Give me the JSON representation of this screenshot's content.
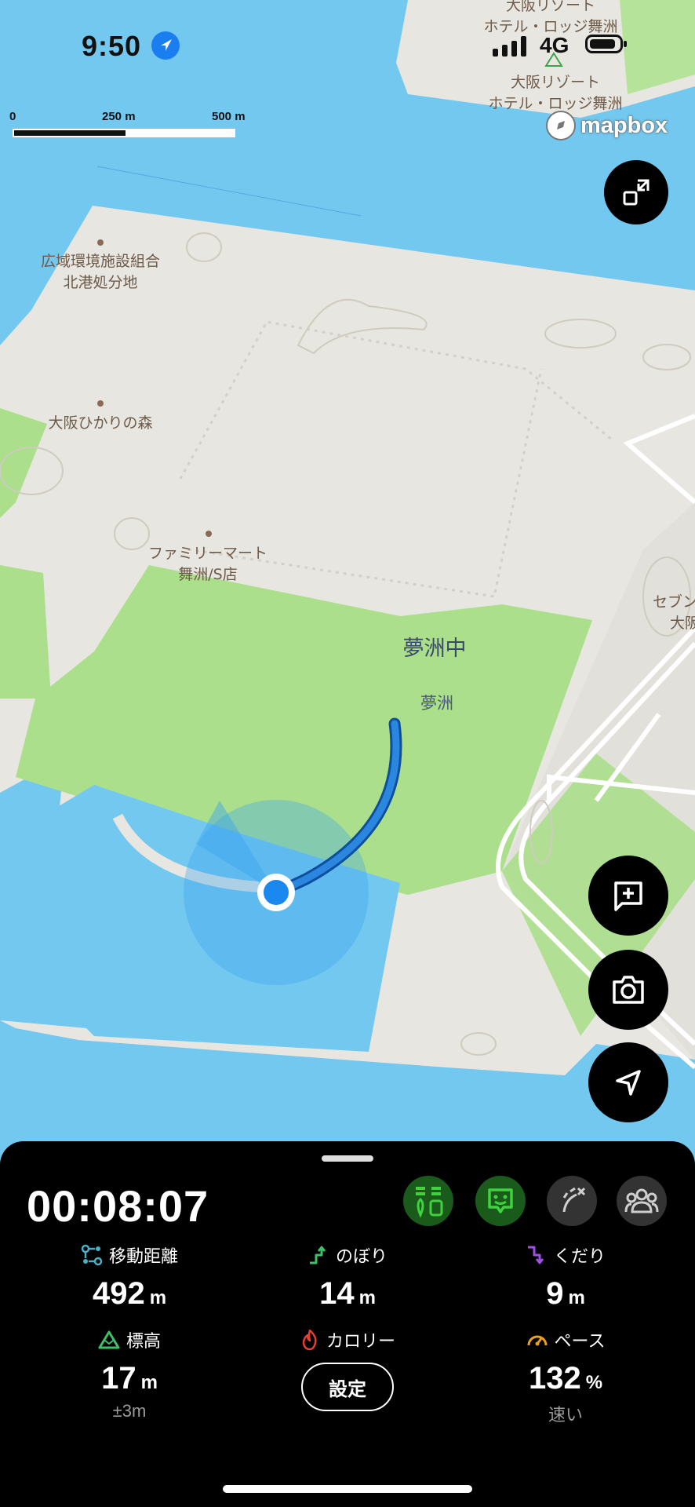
{
  "status_bar": {
    "time": "9:50",
    "network": "4G"
  },
  "map": {
    "scale": {
      "label_0": "0",
      "label_mid": "250 m",
      "label_max": "500 m"
    },
    "attribution": "mapbox",
    "labels": {
      "facility": [
        "広域環境施設組合",
        "北港処分地"
      ],
      "forest": "大阪ひかりの森",
      "store": [
        "ファミリーマート",
        "舞洲/S店"
      ],
      "school": "夢洲中",
      "area": "夢洲",
      "resort_top": [
        "大阪リゾート",
        "ホテル・ロッジ舞洲"
      ],
      "resort": [
        "大阪リゾート",
        "ホテル・ロッジ舞洲"
      ],
      "right_edge": [
        "セブン",
        "大阪"
      ]
    }
  },
  "buttons": {
    "collapse": "collapse-icon",
    "add_note": "add-note-icon",
    "camera": "camera-icon",
    "locate": "navigation-arrow-icon"
  },
  "panel": {
    "timer": "00:08:07",
    "tools": [
      "route-markers-icon",
      "chat-face-icon",
      "route-off-icon",
      "group-icon"
    ],
    "tool_colors": {
      "active_bg": "#1a5a1a",
      "active_fg": "#3fd23f",
      "inactive_bg": "#333333",
      "inactive_fg": "#cfcfcf"
    },
    "stats": {
      "distance": {
        "label": "移動距離",
        "value": "492",
        "unit": "m"
      },
      "ascent": {
        "label": "のぼり",
        "value": "14",
        "unit": "m"
      },
      "descent": {
        "label": "くだり",
        "value": "9",
        "unit": "m"
      },
      "elevation": {
        "label": "標高",
        "value": "17",
        "unit": "m",
        "sub": "±3m"
      },
      "calories": {
        "label": "カロリー",
        "button": "設定"
      },
      "pace": {
        "label": "ペース",
        "value": "132",
        "unit": "%",
        "sub": "速い"
      }
    }
  },
  "colors": {
    "water": "#73c8f0",
    "land": "#e8e6e1",
    "park": "#abdf8c",
    "track": "#1f78d6",
    "stat_distance": "#4ab0c8",
    "stat_ascent": "#3fbf6a",
    "stat_descent": "#a050e0",
    "stat_elevation": "#3fbf6a",
    "stat_calories": "#e84030",
    "stat_pace": "#e8a020"
  }
}
